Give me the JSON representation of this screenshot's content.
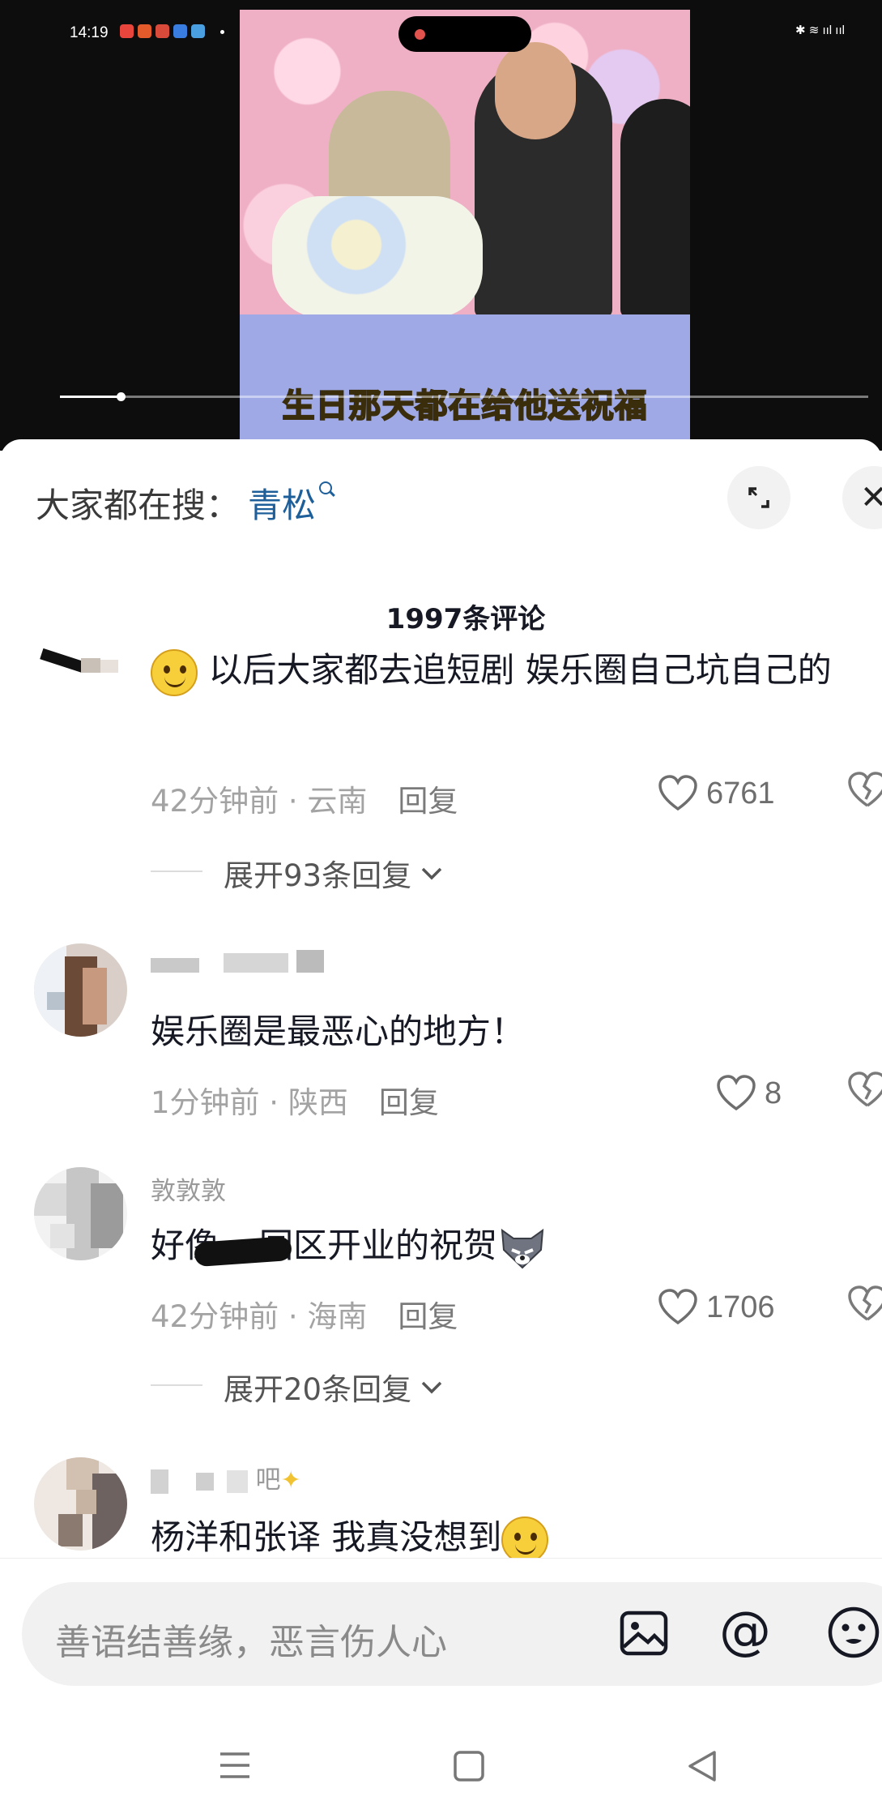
{
  "status_bar": {
    "time": "14:19",
    "right_icons": "✱ ≋ ııl ııl"
  },
  "video": {
    "caption": "生日那天都在给他送祝福",
    "progress_fraction": 0.075
  },
  "search_suggest": {
    "label": "大家都在搜：",
    "term": "青松"
  },
  "comments_header": {
    "count_label": "1997条评论"
  },
  "comments": [
    {
      "username": "",
      "text": "以后大家都去追短剧 娱乐圈自己坑自己的",
      "time_location": "42分钟前 · 云南",
      "reply_label": "回复",
      "likes": "6761",
      "expand_label": "展开93条回复"
    },
    {
      "username": "",
      "text": "娱乐圈是最恶心的地方！",
      "time_location": "1分钟前 · 陕西",
      "reply_label": "回复",
      "likes": "8"
    },
    {
      "username": "敦敦敦",
      "text_before": "好像",
      "text_after": "园区开业的祝贺",
      "time_location": "42分钟前 · 海南",
      "reply_label": "回复",
      "likes": "1706",
      "expand_label": "展开20条回复"
    },
    {
      "username": "吧",
      "text": "杨洋和张译 我真没想到"
    }
  ],
  "input": {
    "placeholder": "善语结善缘，恶言伤人心",
    "at_symbol": "@"
  },
  "icons": {
    "expand": "expand-icon",
    "close": "close-icon",
    "like": "heart-icon",
    "dislike": "broken-heart-icon",
    "image": "image-icon",
    "emoji": "emoji-icon"
  }
}
